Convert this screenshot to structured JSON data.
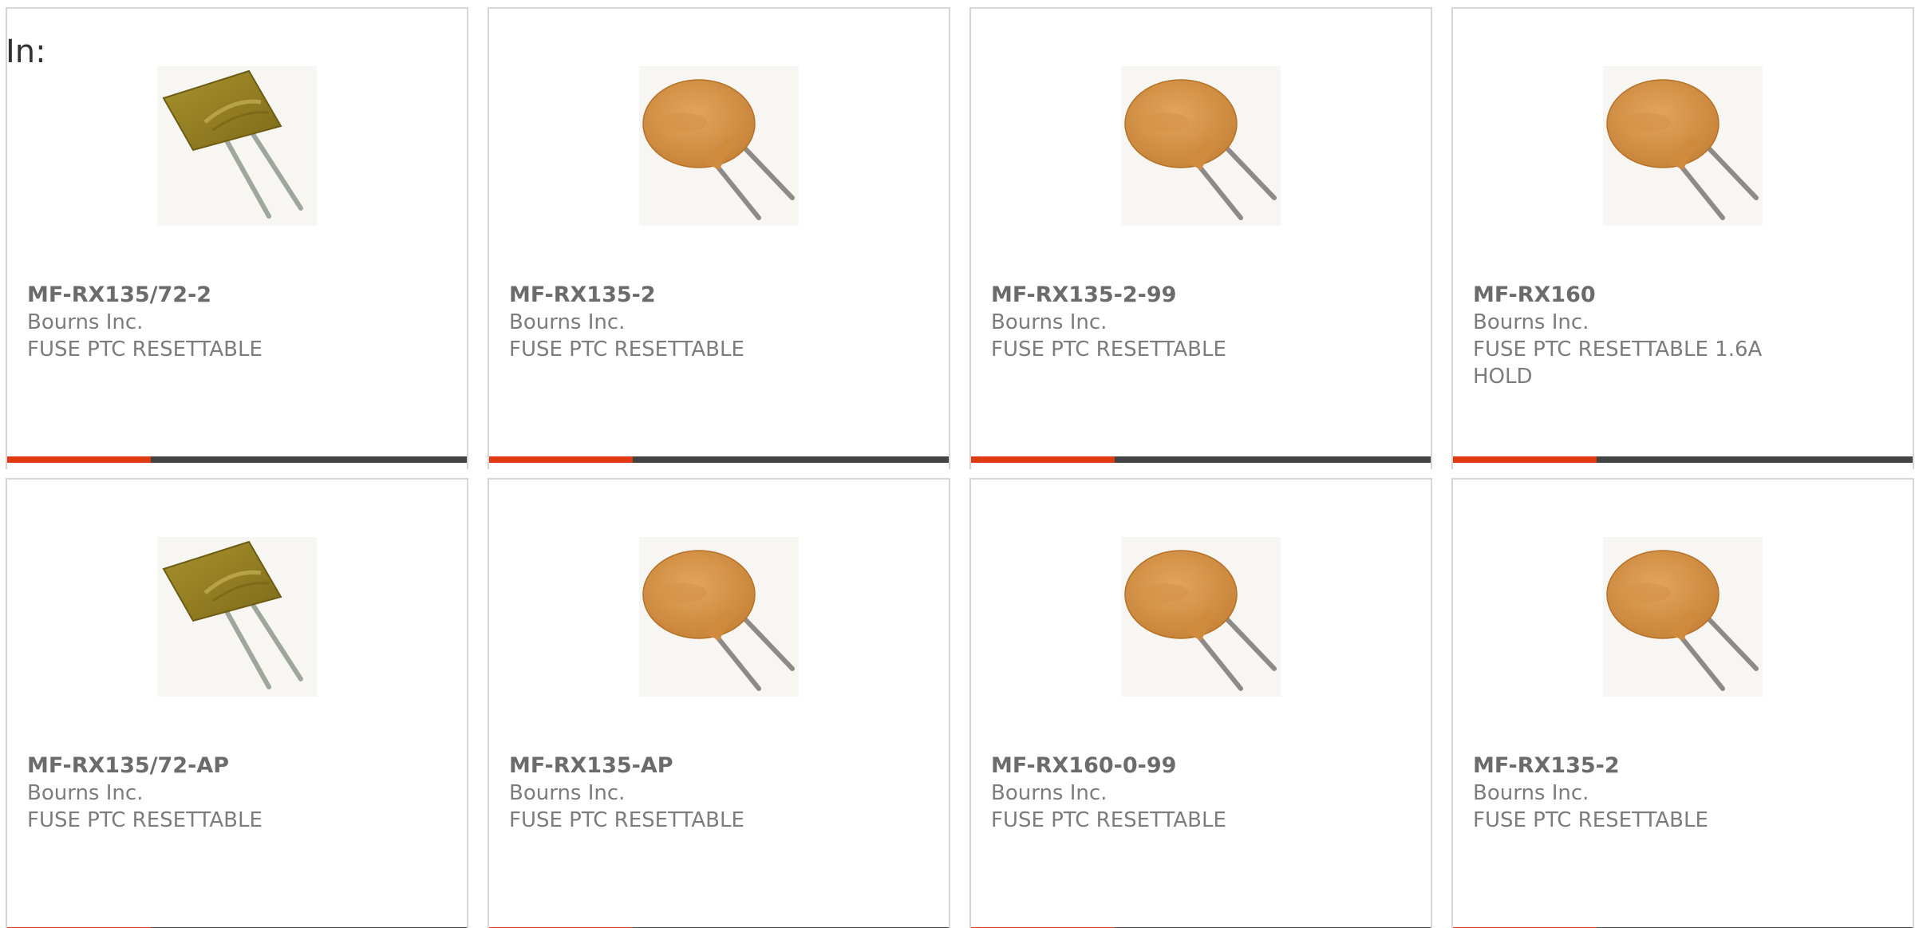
{
  "page": {
    "prefix_label": "In:",
    "accent_color": "#e03a12",
    "bar_color": "#434343",
    "text_color": "#6b6b6b"
  },
  "products": [
    {
      "part": "MF-RX135/72-2",
      "manufacturer": "Bourns Inc.",
      "description": "FUSE PTC RESETTABLE",
      "image": "square-ptc-fuse"
    },
    {
      "part": "MF-RX135-2",
      "manufacturer": "Bourns Inc.",
      "description": "FUSE PTC RESETTABLE",
      "image": "radial-ptc-fuse"
    },
    {
      "part": "MF-RX135-2-99",
      "manufacturer": "Bourns Inc.",
      "description": "FUSE PTC RESETTABLE",
      "image": "radial-ptc-fuse"
    },
    {
      "part": "MF-RX160",
      "manufacturer": "Bourns Inc.",
      "description": "FUSE PTC RESETTABLE 1.6A HOLD",
      "image": "radial-ptc-fuse"
    },
    {
      "part": "MF-RX135/72-AP",
      "manufacturer": "Bourns Inc.",
      "description": "FUSE PTC RESETTABLE",
      "image": "square-ptc-fuse"
    },
    {
      "part": "MF-RX135-AP",
      "manufacturer": "Bourns Inc.",
      "description": "FUSE PTC RESETTABLE",
      "image": "radial-ptc-fuse"
    },
    {
      "part": "MF-RX160-0-99",
      "manufacturer": "Bourns Inc.",
      "description": "FUSE PTC RESETTABLE",
      "image": "radial-ptc-fuse"
    },
    {
      "part": "MF-RX135-2",
      "manufacturer": "Bourns Inc.",
      "description": "FUSE PTC RESETTABLE",
      "image": "radial-ptc-fuse"
    }
  ]
}
